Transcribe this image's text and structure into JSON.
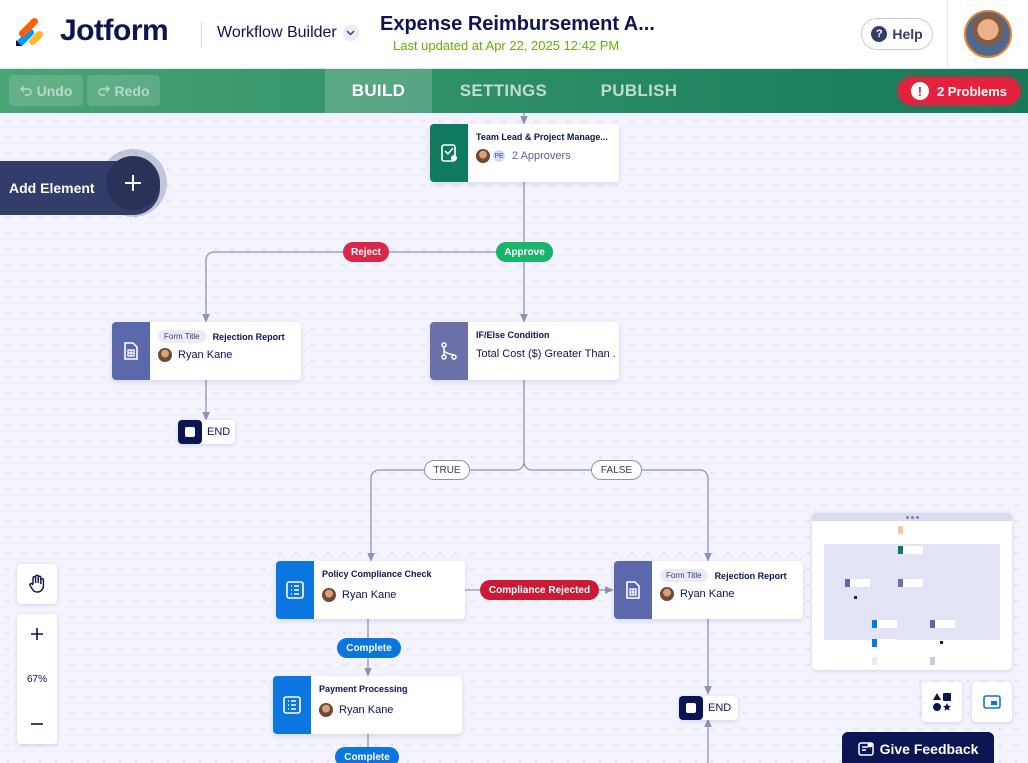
{
  "header": {
    "brand": "Jotform",
    "section": "Workflow Builder",
    "doc_title": "Expense Reimbursement A...",
    "last_updated": "Last updated at Apr 22, 2025 12:42 PM",
    "help_label": "Help"
  },
  "toolbar": {
    "undo_label": "Undo",
    "redo_label": "Redo",
    "tabs": [
      "BUILD",
      "SETTINGS",
      "PUBLISH"
    ],
    "active_tab": "BUILD",
    "problems_label": "2 Problems"
  },
  "canvas": {
    "add_element_label": "Add Element",
    "zoom_label": "67%",
    "feedback_label": "Give Feedback",
    "nodes": {
      "approval": {
        "title": "Team Lead & Project Manage...",
        "badge": "PE",
        "subtitle": "2 Approvers",
        "color": "#0f7a5d"
      },
      "rejection_left": {
        "tag": "Form Title",
        "title": "Rejection Report",
        "assignee": "Ryan Kane",
        "color": "#5b68ac"
      },
      "ifelse": {
        "title": "IF/Else Condition",
        "subtitle": "Total Cost ($) Greater Than ...",
        "color": "#6b71a8"
      },
      "policy": {
        "title": "Policy Compliance Check",
        "assignee": "Ryan Kane",
        "color": "#0b75e0"
      },
      "rejection_right": {
        "tag": "Form Title",
        "title": "Rejection Report",
        "assignee": "Ryan Kane",
        "color": "#5b68ac"
      },
      "payment": {
        "title": "Payment Processing",
        "assignee": "Ryan Kane",
        "color": "#0b75e0"
      }
    },
    "labels": {
      "reject": "Reject",
      "approve": "Approve",
      "true": "TRUE",
      "false": "FALSE",
      "compliance_rejected": "Compliance Rejected",
      "complete_1": "Complete",
      "complete_2": "Complete"
    },
    "end_label": "END"
  },
  "colors": {
    "reject": "#d9274a",
    "approve": "#19b46a",
    "complete": "#0b75e0",
    "compliance_rejected": "#cc1a36",
    "problems": "#e4213f"
  }
}
